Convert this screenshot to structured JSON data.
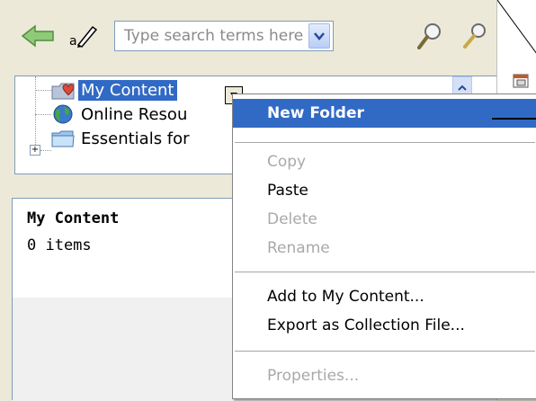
{
  "toolbar": {
    "back_icon": "green-left-arrow-icon",
    "edit_icon": "pen-icon",
    "search_placeholder": "Type search terms here",
    "dropdown_icon": "chevron-down-icon",
    "search_icon": "magnifier-icon",
    "advanced_search_icon": "magnifier-pen-icon"
  },
  "tree": {
    "items": [
      {
        "label": "My Content",
        "icon": "folder-with-heart-icon",
        "selected": true
      },
      {
        "label": "Online Resou",
        "icon": "globe-icon",
        "selected": false
      },
      {
        "label": "Essentials for",
        "icon": "folder-icon",
        "selected": false,
        "expander": "+"
      }
    ]
  },
  "content": {
    "title": "My Content",
    "count": "0 items"
  },
  "context_menu": {
    "items": [
      {
        "label": "New Folder",
        "state": "highlighted"
      },
      {
        "label": "Copy",
        "state": "disabled"
      },
      {
        "label": "Paste",
        "state": "enabled"
      },
      {
        "label": "Delete",
        "state": "disabled"
      },
      {
        "label": "Rename",
        "state": "disabled"
      },
      {
        "label": "Add to My Content...",
        "state": "enabled"
      },
      {
        "label": "Export as Collection File...",
        "state": "enabled"
      },
      {
        "label": "Properties...",
        "state": "disabled"
      }
    ]
  },
  "colors": {
    "selection": "#316ac5",
    "panel_bg": "#ece9d8",
    "border": "#7f9db9",
    "disabled_text": "#a9a9a9"
  }
}
